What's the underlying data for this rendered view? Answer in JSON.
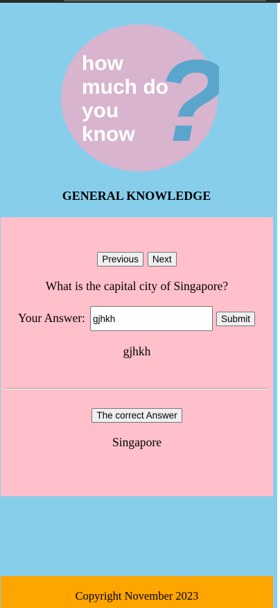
{
  "logo": {
    "lines": [
      "how",
      "much do",
      "you",
      "know"
    ],
    "mark": "?",
    "circle_color": "#d8b4cf",
    "text_color": "#ffffff",
    "mark_color": "#5aa5cc"
  },
  "heading": "GENERAL KNOWLEDGE",
  "quiz": {
    "previous_label": "Previous",
    "next_label": "Next",
    "question": "What is the capital city of Singapore?",
    "answer_label": "Your Answer:",
    "answer_value": "gjhkh",
    "submit_label": "Submit",
    "submitted_answer": "gjhkh",
    "correct_button_label": "The correct Answer",
    "correct_answer": "Singapore"
  },
  "footer": {
    "text": "Copyright November 2023"
  },
  "colors": {
    "background": "#87ceeb",
    "panel": "#ffc0cb",
    "footer": "#ffa500"
  }
}
